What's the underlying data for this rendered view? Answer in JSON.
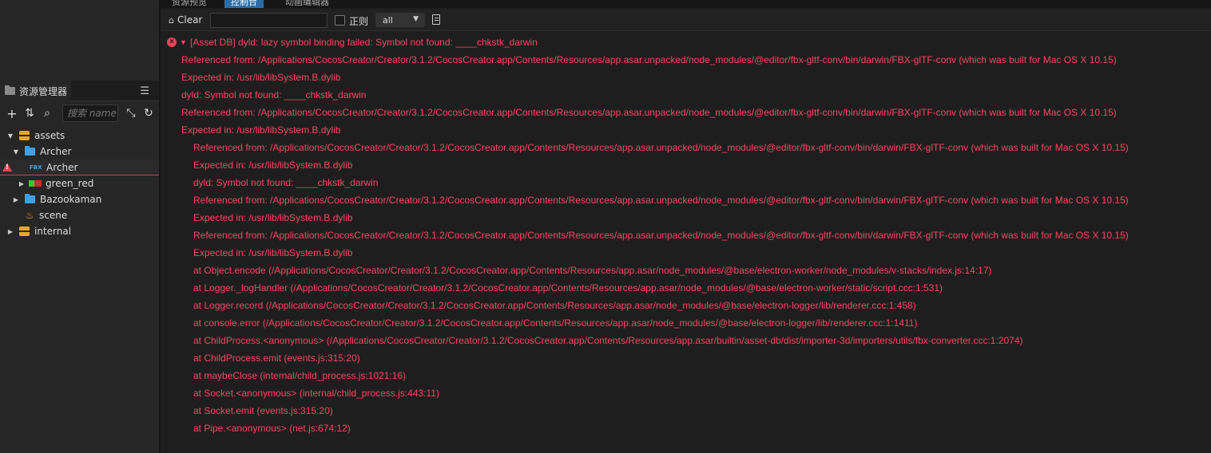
{
  "left_panel": {
    "tab_label": "资源管理器",
    "menu_icon": "hamburger-icon",
    "search_placeholder": "搜索 name",
    "tree": [
      {
        "label": "assets",
        "icon": "database-icon",
        "expanded": true
      },
      {
        "label": "Archer",
        "icon": "folder-icon",
        "expanded": true
      },
      {
        "label": "Archer",
        "icon": "fbx-icon",
        "badge": "FBX",
        "warning": true,
        "selected": true
      },
      {
        "label": "green_red",
        "icon": "material-icon",
        "expanded": false
      },
      {
        "label": "Bazookaman",
        "icon": "folder-icon",
        "expanded": false
      },
      {
        "label": "scene",
        "icon": "scene-icon"
      },
      {
        "label": "internal",
        "icon": "database-icon",
        "expanded": false
      }
    ]
  },
  "tabs": [
    {
      "label": "资源预览",
      "active": false
    },
    {
      "label": "控制台",
      "active": true
    },
    {
      "label": "动画编辑器",
      "active": false
    }
  ],
  "console_toolbar": {
    "clear_label": "Clear",
    "filter_value": "",
    "regex_label": "正则",
    "level_value": "all"
  },
  "log": {
    "head": "[Asset DB] dyld: lazy symbol binding failed: Symbol not found: ____chkstk_darwin",
    "lines": [
      {
        "text": "Referenced from: /Applications/CocosCreator/Creator/3.1.2/CocosCreator.app/Contents/Resources/app.asar.unpacked/node_modules/@editor/fbx-gltf-conv/bin/darwin/FBX-glTF-conv (which was built for Mac OS X 10.15)",
        "indent": 1
      },
      {
        "text": "Expected in: /usr/lib/libSystem.B.dylib",
        "indent": 1
      },
      {
        "text": "dyld: Symbol not found: ____chkstk_darwin",
        "indent": 1
      },
      {
        "text": "Referenced from: /Applications/CocosCreator/Creator/3.1.2/CocosCreator.app/Contents/Resources/app.asar.unpacked/node_modules/@editor/fbx-gltf-conv/bin/darwin/FBX-glTF-conv (which was built for Mac OS X 10.15)",
        "indent": 1
      },
      {
        "text": "Expected in: /usr/lib/libSystem.B.dylib",
        "indent": 1
      },
      {
        "text": "Referenced from: /Applications/CocosCreator/Creator/3.1.2/CocosCreator.app/Contents/Resources/app.asar.unpacked/node_modules/@editor/fbx-gltf-conv/bin/darwin/FBX-glTF-conv (which was built for Mac OS X 10.15)",
        "indent": 2
      },
      {
        "text": "Expected in: /usr/lib/libSystem.B.dylib",
        "indent": 2
      },
      {
        "text": "dyld: Symbol not found: ____chkstk_darwin",
        "indent": 2
      },
      {
        "text": "Referenced from: /Applications/CocosCreator/Creator/3.1.2/CocosCreator.app/Contents/Resources/app.asar.unpacked/node_modules/@editor/fbx-gltf-conv/bin/darwin/FBX-glTF-conv (which was built for Mac OS X 10.15)",
        "indent": 2
      },
      {
        "text": "Expected in: /usr/lib/libSystem.B.dylib",
        "indent": 2
      },
      {
        "text": "Referenced from: /Applications/CocosCreator/Creator/3.1.2/CocosCreator.app/Contents/Resources/app.asar.unpacked/node_modules/@editor/fbx-gltf-conv/bin/darwin/FBX-glTF-conv (which was built for Mac OS X 10.15)",
        "indent": 2
      },
      {
        "text": "Expected in: /usr/lib/libSystem.B.dylib",
        "indent": 2
      },
      {
        "text": "at Object.encode (/Applications/CocosCreator/Creator/3.1.2/CocosCreator.app/Contents/Resources/app.asar/node_modules/@base/electron-worker/node_modules/v-stacks/index.js:14:17)",
        "indent": 2
      },
      {
        "text": "at Logger._logHandler (/Applications/CocosCreator/Creator/3.1.2/CocosCreator.app/Contents/Resources/app.asar/node_modules/@base/electron-worker/static/script.ccc:1:531)",
        "indent": 2
      },
      {
        "text": "at Logger.record (/Applications/CocosCreator/Creator/3.1.2/CocosCreator.app/Contents/Resources/app.asar/node_modules/@base/electron-logger/lib/renderer.ccc:1:458)",
        "indent": 2
      },
      {
        "text": "at console.error (/Applications/CocosCreator/Creator/3.1.2/CocosCreator.app/Contents/Resources/app.asar/node_modules/@base/electron-logger/lib/renderer.ccc:1:1411)",
        "indent": 2
      },
      {
        "text": "at ChildProcess.<anonymous> (/Applications/CocosCreator/Creator/3.1.2/CocosCreator.app/Contents/Resources/app.asar/builtin/asset-db/dist/importer-3d/importers/utils/fbx-converter.ccc:1:2074)",
        "indent": 2
      },
      {
        "text": "at ChildProcess.emit (events.js:315:20)",
        "indent": 2
      },
      {
        "text": "at maybeClose (internal/child_process.js:1021:16)",
        "indent": 2
      },
      {
        "text": "at Socket.<anonymous> (internal/child_process.js:443:11)",
        "indent": 2
      },
      {
        "text": "at Socket.emit (events.js:315:20)",
        "indent": 2
      },
      {
        "text": "at Pipe.<anonymous> (net.js:674:12)",
        "indent": 2
      }
    ]
  },
  "colors": {
    "error_text": "#f24864",
    "active_tab": "#2b6ea6",
    "folder": "#3aa1e8",
    "database": "#e3a82b"
  }
}
